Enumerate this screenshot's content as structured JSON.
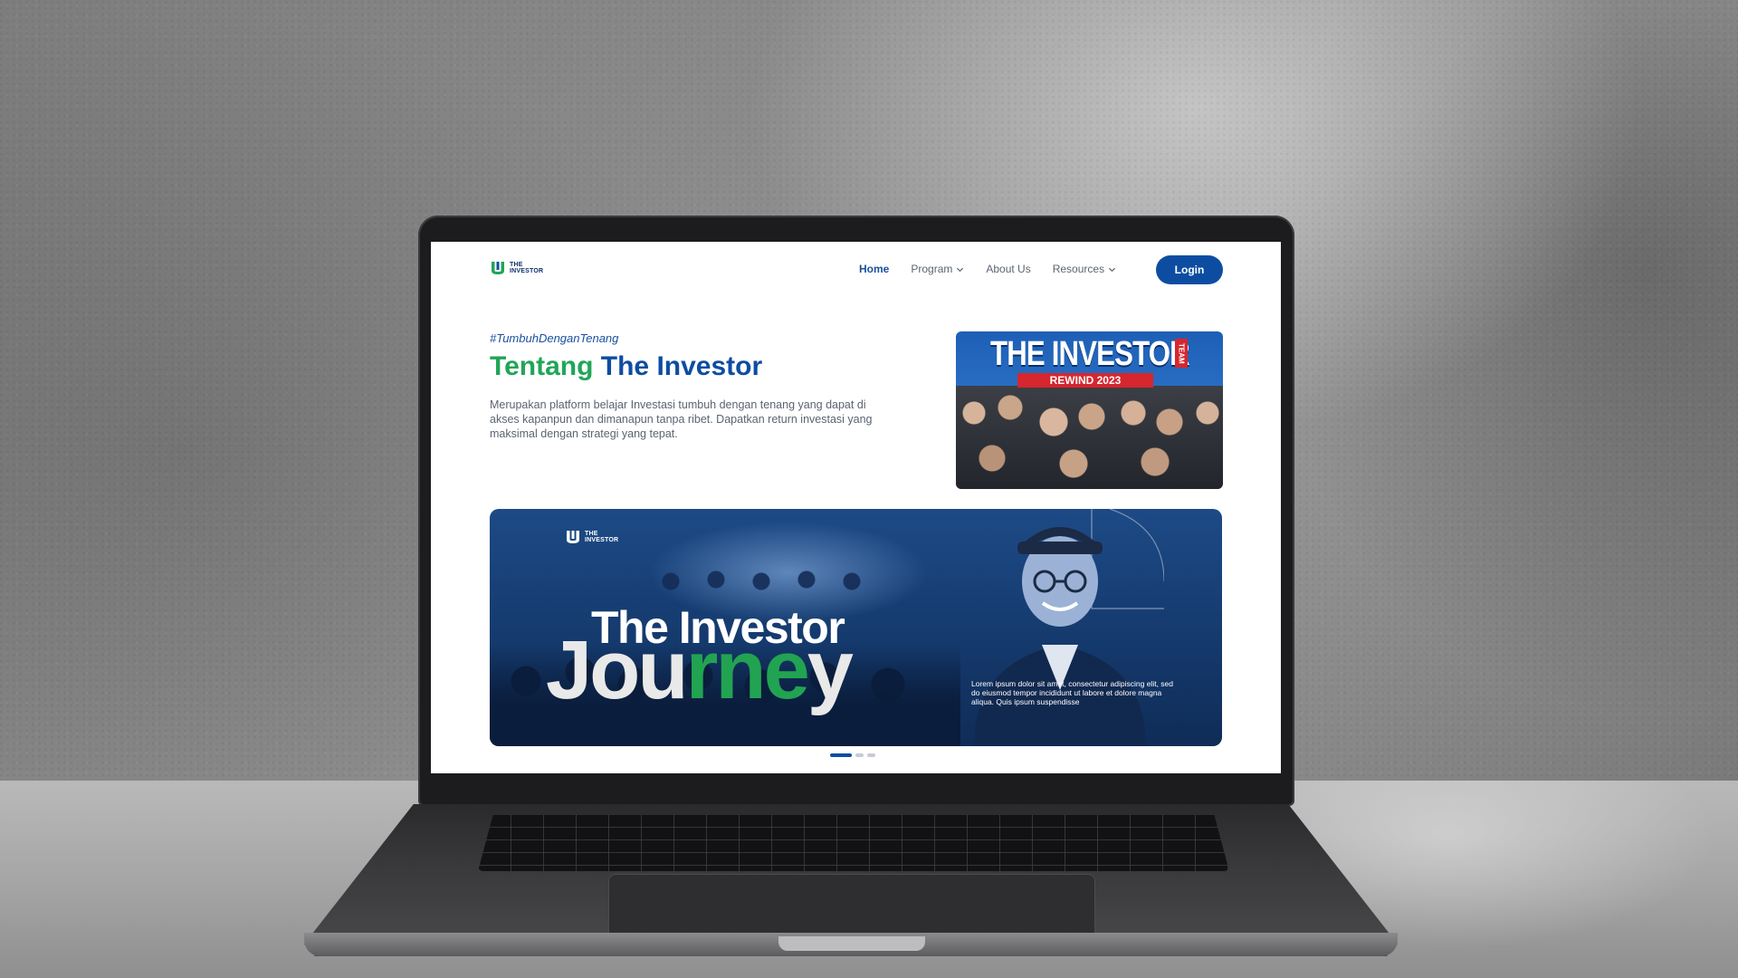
{
  "brand": {
    "logo_line1": "THE",
    "logo_line2": "INVESTOR",
    "primary_color": "#0d4da1",
    "accent_green": "#21a559"
  },
  "nav": {
    "items": [
      {
        "label": "Home",
        "active": true,
        "dropdown": false
      },
      {
        "label": "Program",
        "active": false,
        "dropdown": true,
        "icon": "chevron-down-icon"
      },
      {
        "label": "About Us",
        "active": false,
        "dropdown": false
      },
      {
        "label": "Resources",
        "active": false,
        "dropdown": true,
        "icon": "chevron-down-icon"
      }
    ],
    "login_label": "Login"
  },
  "hero": {
    "hashtag": "#TumbuhDenganTenang",
    "title_green": "Tentang",
    "title_blue": "The Investor",
    "description": "Merupakan platform belajar Investasi tumbuh dengan tenang yang dapat di akses kapanpun dan dimanapun tanpa ribet. Dapatkan return investasi yang maksimal dengan strategi yang tepat."
  },
  "rewind_card": {
    "title": "THE INVESTOR",
    "tag": "TEAM",
    "subtitle": "REWIND 2023"
  },
  "banner": {
    "logo_line1": "THE",
    "logo_line2": "INVESTOR",
    "title": "The Investor",
    "subtitle_part1": "Jou",
    "subtitle_part2": "rne",
    "subtitle_part3": "y",
    "body": "Lorem ipsum dolor sit amet, consectetur adipiscing elit, sed do eiusmod tempor incididunt ut labore et dolore magna aliqua. Quis ipsum suspendisse"
  },
  "carousel": {
    "total": 3,
    "active_index": 0
  }
}
